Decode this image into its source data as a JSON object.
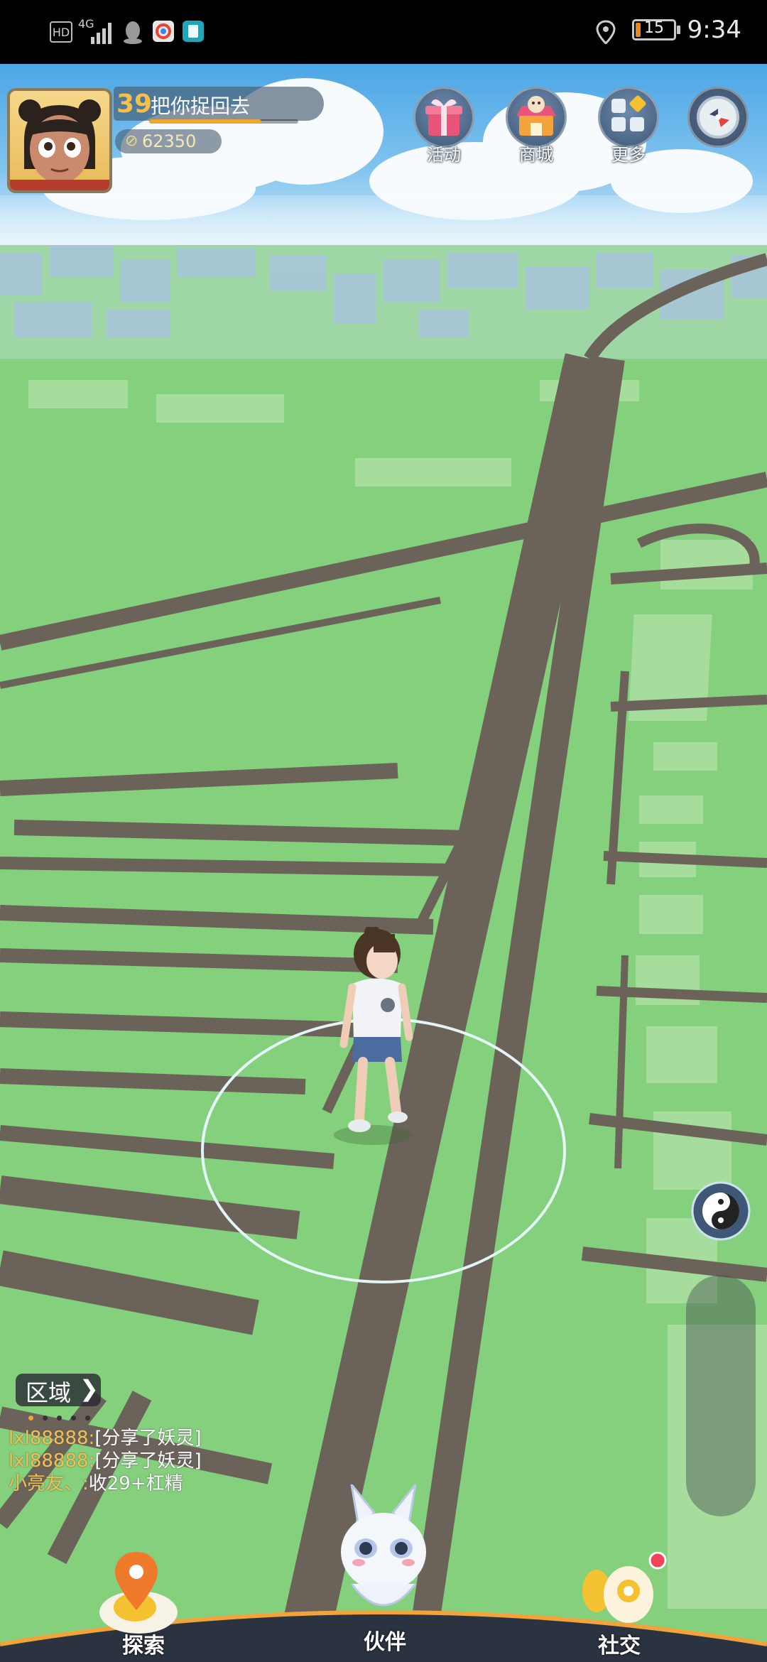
{
  "status_bar": {
    "hd": "HD",
    "network": "4G",
    "battery_level": 15,
    "battery_text": "15",
    "time": "9:34"
  },
  "player": {
    "level": "39",
    "name": "把你捉回去",
    "xp_fraction": 0.75,
    "coins": "62350"
  },
  "top_buttons": [
    {
      "label": "活动",
      "icon": "gift-icon"
    },
    {
      "label": "商城",
      "icon": "shop-icon"
    },
    {
      "label": "更多",
      "icon": "more-grid-icon"
    }
  ],
  "compass_icon": "compass-icon",
  "region": {
    "label": "区域",
    "chevron": "❯"
  },
  "chat": [
    {
      "name": "lxl88888:",
      "text": "[分享了妖灵]"
    },
    {
      "name": "lxl88888:",
      "text": "[分享了妖灵]"
    },
    {
      "name": "小亮友、:",
      "text": "收29+杠精"
    }
  ],
  "bottom_nav": [
    {
      "label": "探索",
      "icon": "map-pin-icon"
    },
    {
      "label": "伙伴",
      "icon": "companion-spirit-icon"
    },
    {
      "label": "社交",
      "icon": "social-icon"
    }
  ],
  "colors": {
    "grass": "#82cf7a",
    "road": "#6b625a",
    "sky": "#5aaee8",
    "accent_gold": "#f2c24f"
  }
}
